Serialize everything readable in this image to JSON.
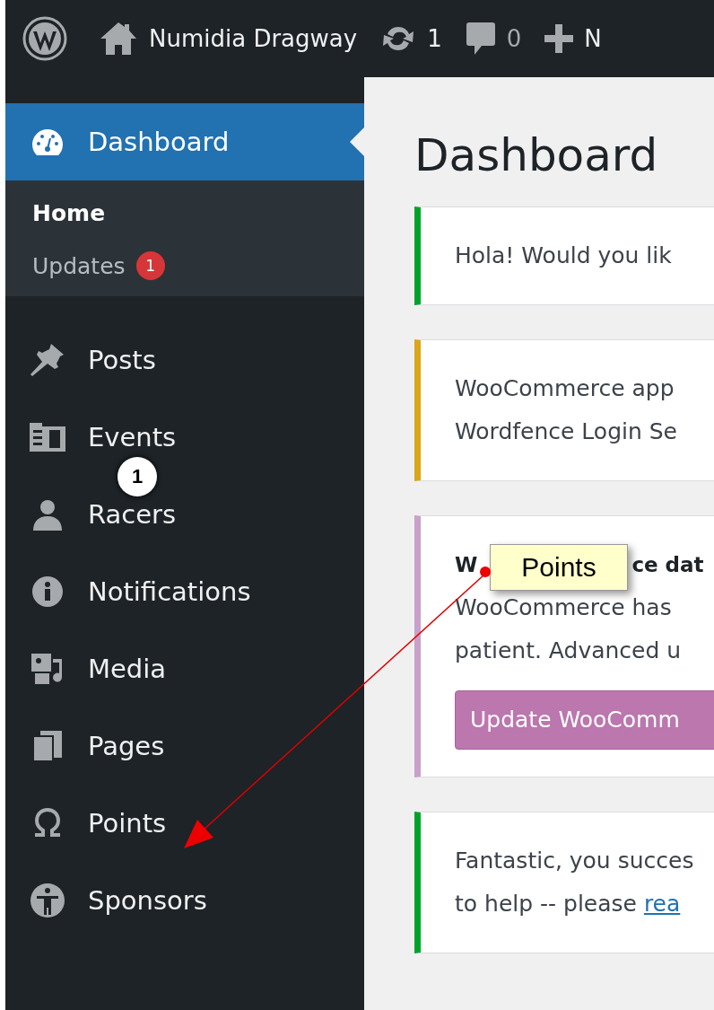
{
  "admin_bar": {
    "site_name": "Numidia Dragway",
    "updates_count": "1",
    "comments_count": "0",
    "new_label": "N"
  },
  "sidebar": {
    "items": [
      {
        "label": "Dashboard",
        "selected": true,
        "children": [
          {
            "label": "Home",
            "selected": true
          },
          {
            "label": "Updates",
            "selected": false,
            "badge": "1"
          }
        ]
      },
      {
        "label": "Posts",
        "selected": false
      },
      {
        "label": "Events",
        "selected": false
      },
      {
        "label": "Racers",
        "selected": false
      },
      {
        "label": "Notifications",
        "selected": false
      },
      {
        "label": "Media",
        "selected": false
      },
      {
        "label": "Pages",
        "selected": false
      },
      {
        "label": "Points",
        "selected": false
      },
      {
        "label": "Sponsors",
        "selected": false
      }
    ]
  },
  "content": {
    "title": "Dashboard",
    "notices": [
      {
        "color": "#00a32a",
        "lines": [
          "Hola! Would you lik"
        ]
      },
      {
        "color": "#dba617",
        "lines": [
          "WooCommerce app",
          "Wordfence Login Se"
        ]
      },
      {
        "color": "#c9a0c9",
        "title_parts": [
          "W",
          "ce dat"
        ],
        "lines": [
          "WooCommerce has",
          "patient. Advanced u"
        ],
        "button": "Update WooComm"
      },
      {
        "color": "#00a32a",
        "lines": [
          "Fantastic, you succes"
        ],
        "last_line": "to help -- please ",
        "link": "rea"
      }
    ]
  },
  "annotations": {
    "marker": "1",
    "callout": "Points"
  }
}
